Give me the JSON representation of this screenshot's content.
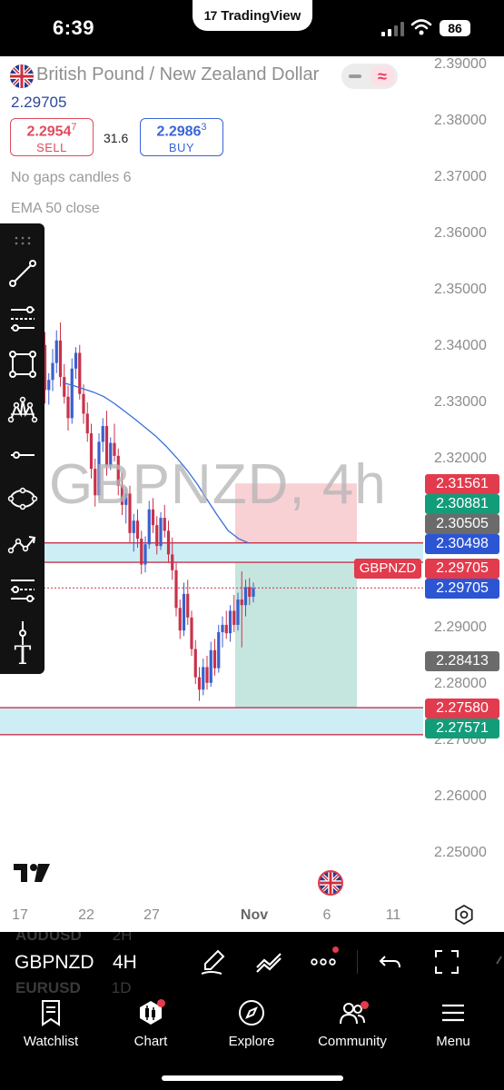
{
  "status_bar": {
    "time": "6:39",
    "app_label": "TradingView",
    "battery": "86"
  },
  "header": {
    "symbol_name": "British Pound / New Zealand Dollar",
    "last_price": "2.29705",
    "sell": {
      "price_main": "2.2954",
      "price_sup": "7",
      "label": "SELL"
    },
    "spread": "31.6",
    "buy": {
      "price_main": "2.2986",
      "price_sup": "3",
      "label": "BUY"
    },
    "indicators": [
      "No gaps candles 6",
      "EMA 50 close"
    ]
  },
  "chart": {
    "watermark": "GBPNZD, 4h",
    "y_axis_ticks": [
      "2.39000",
      "2.38000",
      "2.37000",
      "2.36000",
      "2.35000",
      "2.34000",
      "2.33000",
      "2.32000",
      "2.29000",
      "2.28000",
      "2.27000",
      "2.26000",
      "2.25000"
    ],
    "x_axis_ticks": [
      "17",
      "22",
      "27",
      "Nov",
      "6",
      "11"
    ],
    "price_tags": [
      {
        "value": "2.31561",
        "color": "#e23b4d"
      },
      {
        "value": "2.30881",
        "color": "#139c7a"
      },
      {
        "value": "2.30505",
        "color": "#6b6b6b"
      },
      {
        "value": "2.30498",
        "color": "#2c55d4"
      },
      {
        "value": "2.29705",
        "color": "#e23b4d"
      },
      {
        "value": "2.29705",
        "color": "#2c55d4"
      },
      {
        "value": "2.28413",
        "color": "#6b6b6b"
      },
      {
        "value": "2.27580",
        "color": "#e23b4d"
      },
      {
        "value": "2.27571",
        "color": "#139c7a"
      }
    ],
    "symbol_tag": "GBPNZD",
    "colors": {
      "up": "#3a5fcf",
      "down": "#c8324a",
      "ema": "#3a6fd8",
      "stop_zone": "#f7c9cc",
      "target_zone": "#bfe3dc",
      "support_zone": "#cdeef5"
    }
  },
  "chart_data": {
    "type": "candlestick",
    "ylim": [
      2.245,
      2.392
    ],
    "candles": [
      [
        2.3312,
        2.3376,
        2.327,
        2.3345
      ],
      [
        2.3345,
        2.3442,
        2.3318,
        2.3402
      ],
      [
        2.3402,
        2.3425,
        2.3298,
        2.3322
      ],
      [
        2.3322,
        2.3352,
        2.3296,
        2.334
      ],
      [
        2.334,
        2.3395,
        2.332,
        2.337
      ],
      [
        2.337,
        2.3428,
        2.3352,
        2.341
      ],
      [
        2.341,
        2.3442,
        2.3328,
        2.3345
      ],
      [
        2.3345,
        2.3368,
        2.3298,
        2.331
      ],
      [
        2.331,
        2.333,
        2.325,
        2.3272
      ],
      [
        2.3272,
        2.3378,
        2.3262,
        2.336
      ],
      [
        2.336,
        2.3398,
        2.3342,
        2.3388
      ],
      [
        2.3388,
        2.3402,
        2.3305,
        2.3315
      ],
      [
        2.3315,
        2.3332,
        2.3262,
        2.328
      ],
      [
        2.328,
        2.33,
        2.323,
        2.3245
      ],
      [
        2.3245,
        2.3262,
        2.3165,
        2.3182
      ],
      [
        2.3182,
        2.32,
        2.3115,
        2.3135
      ],
      [
        2.3135,
        2.3245,
        2.3125,
        2.323
      ],
      [
        2.323,
        2.3272,
        2.3212,
        2.3258
      ],
      [
        2.3258,
        2.3285,
        2.317,
        2.3188
      ],
      [
        2.3188,
        2.3238,
        2.318,
        2.3228
      ],
      [
        2.3228,
        2.3262,
        2.3195,
        2.3205
      ],
      [
        2.3205,
        2.3218,
        2.3135,
        2.3152
      ],
      [
        2.3152,
        2.3175,
        2.31,
        2.3118
      ],
      [
        2.3118,
        2.315,
        2.3085,
        2.3138
      ],
      [
        2.3138,
        2.3152,
        2.305,
        2.3068
      ],
      [
        2.3068,
        2.3102,
        2.3035,
        2.309
      ],
      [
        2.309,
        2.311,
        2.3042,
        2.3058
      ],
      [
        2.3058,
        2.3072,
        2.2995,
        2.3012
      ],
      [
        2.3012,
        2.3062,
        2.2998,
        2.3048
      ],
      [
        2.3048,
        2.3125,
        2.304,
        2.311
      ],
      [
        2.311,
        2.313,
        2.3068,
        2.3082
      ],
      [
        2.3082,
        2.3098,
        2.303,
        2.3045
      ],
      [
        2.3045,
        2.3105,
        2.3038,
        2.3095
      ],
      [
        2.3095,
        2.3118,
        2.306,
        2.3072
      ],
      [
        2.3072,
        2.309,
        2.3015,
        2.303
      ],
      [
        2.303,
        2.306,
        2.2985,
        2.3002
      ],
      [
        2.3002,
        2.3015,
        2.292,
        2.2935
      ],
      [
        2.2935,
        2.295,
        2.288,
        2.2895
      ],
      [
        2.2895,
        2.298,
        2.2885,
        2.296
      ],
      [
        2.296,
        2.2985,
        2.2905,
        2.2918
      ],
      [
        2.2918,
        2.293,
        2.285,
        2.2862
      ],
      [
        2.2862,
        2.2878,
        2.28,
        2.2812
      ],
      [
        2.2812,
        2.283,
        2.277,
        2.279
      ],
      [
        2.279,
        2.2845,
        2.278,
        2.283
      ],
      [
        2.283,
        2.285,
        2.279,
        2.2802
      ],
      [
        2.2802,
        2.2875,
        2.2795,
        2.286
      ],
      [
        2.286,
        2.288,
        2.2815,
        2.2828
      ],
      [
        2.2828,
        2.2905,
        2.282,
        2.2892
      ],
      [
        2.2892,
        2.292,
        2.2865,
        2.2905
      ],
      [
        2.2905,
        2.293,
        2.288,
        2.289
      ],
      [
        2.289,
        2.294,
        2.2875,
        2.293
      ],
      [
        2.293,
        2.2958,
        2.2892,
        2.2905
      ],
      [
        2.2905,
        2.2962,
        2.2895,
        2.295
      ],
      [
        2.295,
        2.3,
        2.2865,
        2.294
      ],
      [
        2.294,
        2.2985,
        2.292,
        2.2972
      ],
      [
        2.2972,
        2.2988,
        2.294,
        2.2955
      ],
      [
        2.2955,
        2.298,
        2.2945,
        2.297
      ]
    ],
    "ema": [
      2.3335,
      2.333,
      2.3324,
      2.3318,
      2.331,
      2.3298,
      2.3284,
      2.327,
      2.3255,
      2.324,
      2.3222,
      2.3202,
      2.318,
      2.3155,
      2.3126,
      2.3098,
      2.3072,
      2.3058,
      2.305
    ],
    "horizontal_lines": [
      2.30505,
      2.3016,
      2.2758,
      2.271
    ],
    "current_price": 2.29705,
    "position": {
      "entry": 2.3016,
      "stop": 2.30505,
      "stop_top": 2.31561,
      "target": 2.2758
    },
    "support_zone": [
      2.271,
      2.2758
    ],
    "resistance_zone": [
      2.3016,
      2.30505
    ]
  },
  "bottom_controls": {
    "ghost_above": {
      "symbol": "AUDUSD",
      "interval": "2H"
    },
    "symbol": "GBPNZD",
    "interval": "4H",
    "ghost_below": {
      "symbol": "EURUSD",
      "interval": "1D"
    }
  },
  "tabs": [
    {
      "label": "Watchlist",
      "icon": "watchlist-icon"
    },
    {
      "label": "Chart",
      "icon": "chart-icon"
    },
    {
      "label": "Explore",
      "icon": "compass-icon"
    },
    {
      "label": "Community",
      "icon": "community-icon"
    },
    {
      "label": "Menu",
      "icon": "menu-icon"
    }
  ]
}
